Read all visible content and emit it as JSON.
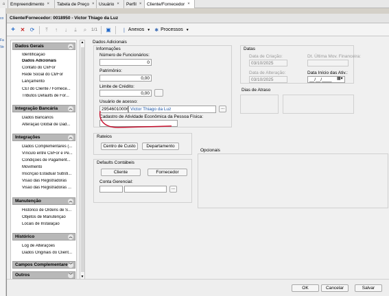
{
  "outer_tabs": [
    {
      "label": "Empreendimento"
    },
    {
      "label": "Tabela de Preço"
    },
    {
      "label": "Usuário"
    },
    {
      "label": "Perfil"
    },
    {
      "label": "Cliente/Fornecedor"
    }
  ],
  "left_strip": [
    "co",
    "Fa",
    "Ve"
  ],
  "window": {
    "title": "Cliente/Fornecedor: 0018950 - Victor Thiago da Luz"
  },
  "toolbar": {
    "record_position": "1/1",
    "attachments_label": "Anexos",
    "processes_label": "Processos"
  },
  "sidebar": {
    "sections": [
      {
        "title": "Dados Gerais",
        "items": [
          "Identificação",
          "Dados Adicionais",
          "Contato do Cli/For",
          "Rede Social do Cli/For",
          "Lançamento",
          "CEI do Cliente / Fornece...",
          "Tributos Defaults de For..."
        ]
      },
      {
        "title": "Integração Bancária",
        "items": [
          "Dados Bancários",
          "Alteração Global de Dad..."
        ]
      },
      {
        "title": "Integrações",
        "items": [
          "Dados Complementares (...",
          "Vínculo entre Cli/For e Pe...",
          "Condições de Pagament...",
          "Movimento",
          "Inscrição Estadual Substi...",
          "Visão das Registradoras",
          "Visão das Registradoras ..."
        ]
      },
      {
        "title": "Manutenção",
        "items": [
          "Histórico de Ordens de S...",
          "Objetos de Manutenção",
          "Locais de Instalação"
        ]
      },
      {
        "title": "Histórico",
        "items": [
          "Log de Alterações",
          "Dados Originais do Client..."
        ]
      },
      {
        "title": "Campos Complementares",
        "items": []
      },
      {
        "title": "Outros",
        "items": []
      }
    ],
    "selected_item": "Dados Adicionais"
  },
  "main": {
    "panel_title": "Dados Adicionais",
    "info": {
      "title": "Informações",
      "num_employees_label": "Número de Funcionários:",
      "num_employees_value": "0",
      "patrimony_label": "Patrimônio:",
      "patrimony_value": "0,00",
      "credit_limit_label": "Limite de Crédito:",
      "credit_limit_value": "0,00",
      "user_access_label": "Usuário de acesso:",
      "user_access_code": "29546010006",
      "user_access_name": "Victor Thiago da Luz",
      "cnae_label": "Cadastro de Atividade Econômica da Pessoa Física:",
      "cnae_value": ""
    },
    "dates": {
      "title": "Datas",
      "creation_label": "Data de Criação:",
      "creation_value": "03/10/2025",
      "last_fin_label": "Dt. Última Mov. Financeira:",
      "last_fin_value": "",
      "alteration_label": "Data de Alteração:",
      "alteration_value": "03/10/2025",
      "start_label": "Data Início das Ativ.:",
      "start_value": "__/__/____"
    },
    "delay_days_label": "Dias de Atraso",
    "delay_days_value": "",
    "apportionment": {
      "title": "Rateios",
      "cost_center_button": "Centro de Custo",
      "department_button": "Departamento"
    },
    "optional_label": "Opcionais",
    "defaults": {
      "title": "Defaults Contábeis",
      "client_button": "Cliente",
      "supplier_button": "Fornecedor",
      "managerial_account_label": "Conta Gerencial:",
      "managerial_account_code": "",
      "managerial_account_name": ""
    }
  },
  "footer": {
    "ok_label": "OK",
    "cancel_label": "Cancelar",
    "save_label": "Salvar"
  },
  "colors": {
    "annotation_red": "#c8102e",
    "link_blue": "#1a54a6"
  }
}
